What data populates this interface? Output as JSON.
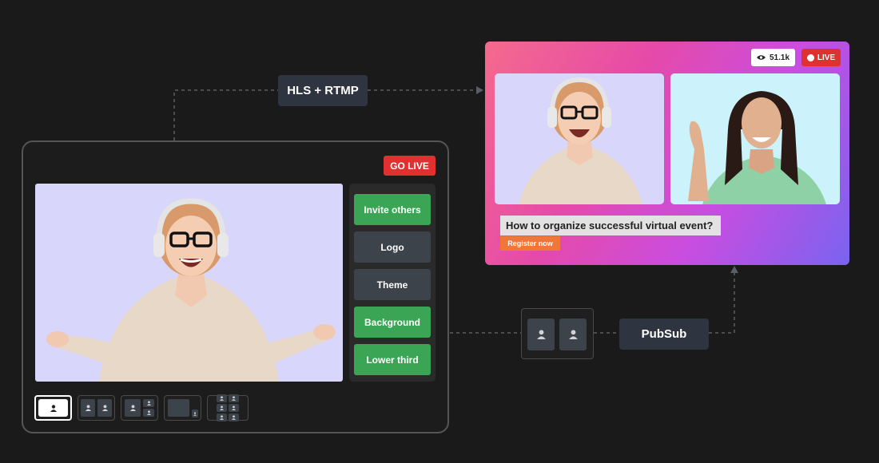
{
  "studio": {
    "go_live_label": "GO LIVE",
    "side_buttons": [
      {
        "label": "Invite others",
        "style": "green"
      },
      {
        "label": "Logo",
        "style": "gray"
      },
      {
        "label": "Theme",
        "style": "gray"
      },
      {
        "label": "Background",
        "style": "green"
      },
      {
        "label": "Lower third",
        "style": "green"
      }
    ],
    "layouts": [
      "single",
      "two-up",
      "one-plus-two",
      "screen-share",
      "grid-six"
    ],
    "active_layout": "single"
  },
  "connectors": {
    "hls_label": "HLS + RTMP",
    "pubsub_label": "PubSub"
  },
  "viewer": {
    "views_count": "51.1k",
    "live_label": "LIVE",
    "lower_third_title": "How to organize successful virtual event?",
    "register_label": "Register now"
  },
  "colors": {
    "background": "#1a1a1a",
    "accent_red": "#e03131",
    "accent_green": "#3aa655",
    "button_gray": "#3d434b",
    "register_orange": "#f0763a",
    "video_bg_lavender": "#d9d6fb",
    "video_bg_cyan": "#ccf2fb"
  }
}
